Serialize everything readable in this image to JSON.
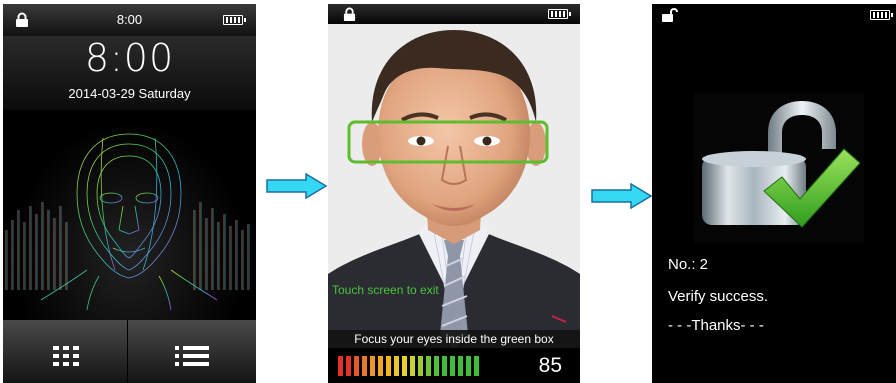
{
  "screen1": {
    "status_time": "8:00",
    "clock": "8:00",
    "date": "2014-03-29  Saturday",
    "icons": [
      "lock-icon",
      "battery-icon",
      "face-scan-icon",
      "apps-grid-icon",
      "menu-list-icon"
    ]
  },
  "screen2": {
    "touch_exit": "Touch screen to exit",
    "instruction": "Focus your eyes inside the green box",
    "score": "85",
    "quality_bar_colors": [
      "#e0342a",
      "#f2a61d",
      "#e7d22a",
      "#3fbd3a"
    ],
    "focus_box_color": "#5cbd2d",
    "icons": [
      "lock-icon",
      "battery-icon"
    ]
  },
  "screen3": {
    "number_label": "No.: 2",
    "verify_text": "Verify success.",
    "thanks_text": "- - -Thanks- - -",
    "icons": [
      "unlocked-padlock-icon",
      "battery-icon",
      "checkmark-icon"
    ]
  },
  "arrow_color": "#35d8f2"
}
